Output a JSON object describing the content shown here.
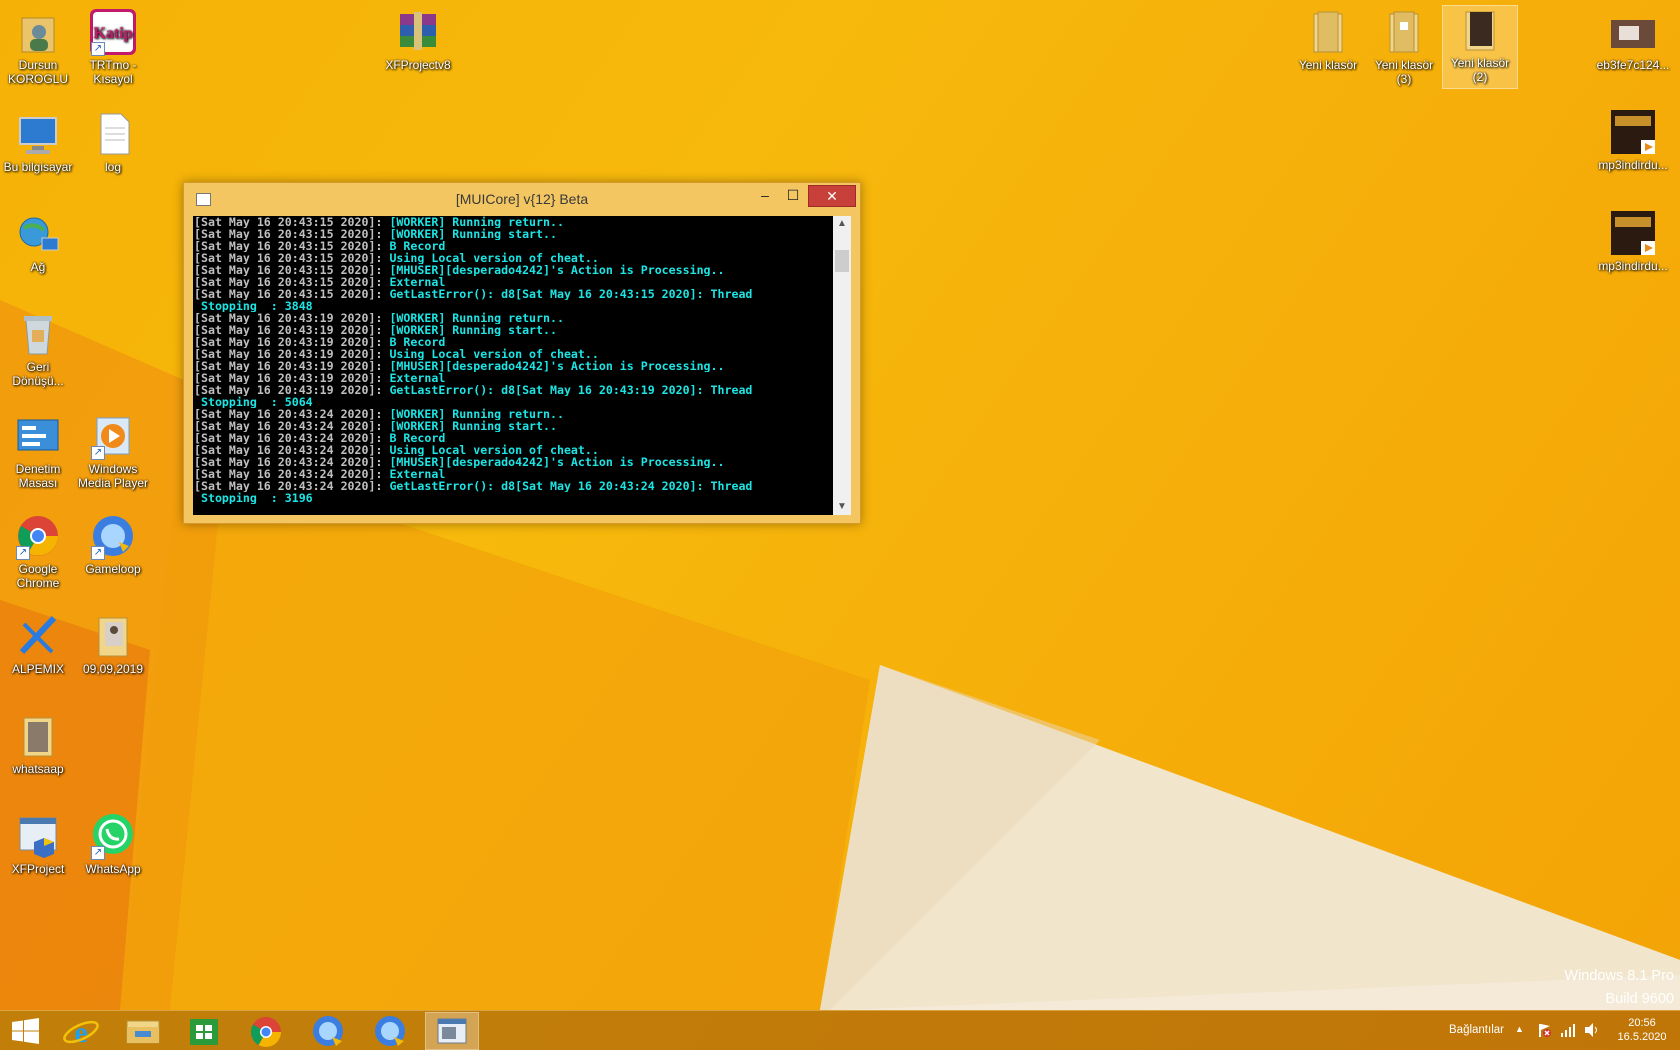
{
  "desktop": {
    "icons": [
      {
        "name": "Dursun KOROGLU",
        "kind": "user-folder"
      },
      {
        "name": "TRTmo - Kısayol",
        "kind": "katip-shortcut",
        "badge": "Katip"
      },
      {
        "name": "XFProjectv8",
        "kind": "winrar-archive"
      },
      {
        "name": "Yeni klasör",
        "kind": "folder"
      },
      {
        "name": "Yeni klasör (3)",
        "kind": "folder"
      },
      {
        "name": "Yeni klasör (2)",
        "kind": "folder-selected"
      },
      {
        "name": "eb3fe7c124...",
        "kind": "image-file"
      },
      {
        "name": "Bu bilgisayar",
        "kind": "computer"
      },
      {
        "name": "log",
        "kind": "text-file"
      },
      {
        "name": "mp3indirdu...",
        "kind": "video-file"
      },
      {
        "name": "mp3indirdu...",
        "kind": "video-file"
      },
      {
        "name": "Ağ",
        "kind": "network"
      },
      {
        "name": "Geri Dönüşü...",
        "kind": "recycle-bin"
      },
      {
        "name": "Denetim Masası",
        "kind": "control-panel"
      },
      {
        "name": "Windows Media Player",
        "kind": "media-player"
      },
      {
        "name": "Google Chrome",
        "kind": "chrome"
      },
      {
        "name": "Gameloop",
        "kind": "gameloop"
      },
      {
        "name": "ALPEMIX",
        "kind": "alpemix"
      },
      {
        "name": "09,09,2019",
        "kind": "folder"
      },
      {
        "name": "whatsaap",
        "kind": "folder"
      },
      {
        "name": "XFProject",
        "kind": "app-window"
      },
      {
        "name": "WhatsApp",
        "kind": "whatsapp"
      }
    ]
  },
  "console": {
    "title": "[MUICore] v{12} Beta",
    "controls": {
      "minimize": "–",
      "maximize": "☐",
      "close": "✕"
    },
    "lines": [
      {
        "ts": "[Sat May 16 20:43:15 2020]: ",
        "msg": "[WORKER] Running return.."
      },
      {
        "ts": "[Sat May 16 20:43:15 2020]: ",
        "msg": "[WORKER] Running start.."
      },
      {
        "ts": "[Sat May 16 20:43:15 2020]: ",
        "msg": "B Record"
      },
      {
        "ts": "[Sat May 16 20:43:15 2020]: ",
        "msg": "Using Local version of cheat.."
      },
      {
        "ts": "[Sat May 16 20:43:15 2020]: ",
        "msg": "[MHUSER][desperado4242]'s Action is Processing.."
      },
      {
        "ts": "[Sat May 16 20:43:15 2020]: ",
        "msg": "External"
      },
      {
        "ts": "[Sat May 16 20:43:15 2020]: ",
        "msg": "GetLastError(): d8[Sat May 16 20:43:15 2020]: Thread"
      },
      {
        "ts": "",
        "msg": " Stopping  : 3848"
      },
      {
        "ts": "[Sat May 16 20:43:19 2020]: ",
        "msg": "[WORKER] Running return.."
      },
      {
        "ts": "[Sat May 16 20:43:19 2020]: ",
        "msg": "[WORKER] Running start.."
      },
      {
        "ts": "[Sat May 16 20:43:19 2020]: ",
        "msg": "B Record"
      },
      {
        "ts": "[Sat May 16 20:43:19 2020]: ",
        "msg": "Using Local version of cheat.."
      },
      {
        "ts": "[Sat May 16 20:43:19 2020]: ",
        "msg": "[MHUSER][desperado4242]'s Action is Processing.."
      },
      {
        "ts": "[Sat May 16 20:43:19 2020]: ",
        "msg": "External"
      },
      {
        "ts": "[Sat May 16 20:43:19 2020]: ",
        "msg": "GetLastError(): d8[Sat May 16 20:43:19 2020]: Thread"
      },
      {
        "ts": "",
        "msg": " Stopping  : 5064"
      },
      {
        "ts": "[Sat May 16 20:43:24 2020]: ",
        "msg": "[WORKER] Running return.."
      },
      {
        "ts": "[Sat May 16 20:43:24 2020]: ",
        "msg": "[WORKER] Running start.."
      },
      {
        "ts": "[Sat May 16 20:43:24 2020]: ",
        "msg": "B Record"
      },
      {
        "ts": "[Sat May 16 20:43:24 2020]: ",
        "msg": "Using Local version of cheat.."
      },
      {
        "ts": "[Sat May 16 20:43:24 2020]: ",
        "msg": "[MHUSER][desperado4242]'s Action is Processing.."
      },
      {
        "ts": "[Sat May 16 20:43:24 2020]: ",
        "msg": "External"
      },
      {
        "ts": "[Sat May 16 20:43:24 2020]: ",
        "msg": "GetLastError(): d8[Sat May 16 20:43:24 2020]: Thread"
      },
      {
        "ts": "",
        "msg": " Stopping  : 3196"
      }
    ]
  },
  "watermark": {
    "line1": "Windows 8.1 Pro",
    "line2": "Build 9600"
  },
  "taskbar": {
    "buttons": [
      {
        "name": "start",
        "icon": "windows-logo-icon"
      },
      {
        "name": "internet-explorer",
        "icon": "ie-icon"
      },
      {
        "name": "file-explorer",
        "icon": "folder-icon"
      },
      {
        "name": "store",
        "icon": "store-icon"
      },
      {
        "name": "chrome",
        "icon": "chrome-icon"
      },
      {
        "name": "gameloop-1",
        "icon": "gameloop-icon"
      },
      {
        "name": "gameloop-2",
        "icon": "gameloop-icon"
      },
      {
        "name": "console-window",
        "icon": "console-icon",
        "active": true
      }
    ],
    "tray": {
      "links_label": "Bağlantılar",
      "show_hidden": "▲",
      "time": "20:56",
      "date": "16.5.2020"
    }
  },
  "colors": {
    "accent": "#f6b106",
    "console_text": "#1ce5e5",
    "console_ts": "#c0c0c0",
    "close_red": "#c7403a"
  }
}
